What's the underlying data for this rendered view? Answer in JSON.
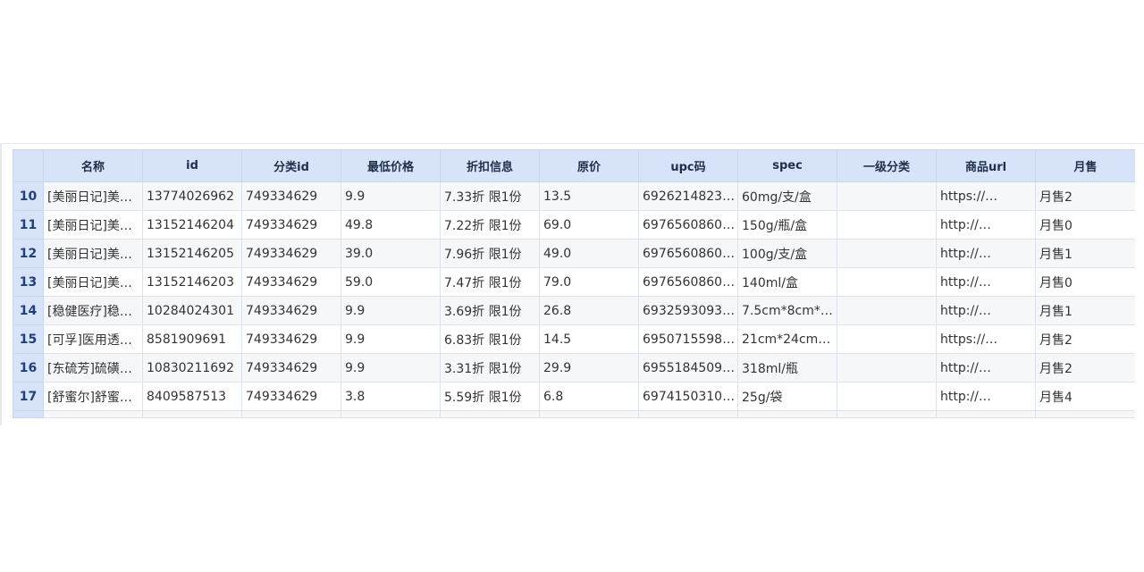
{
  "grid": {
    "columns": [
      "名称",
      "id",
      "分类id",
      "最低价格",
      "折扣信息",
      "原价",
      "upc码",
      "spec",
      "一级分类",
      "商品url",
      "月售"
    ],
    "rows": [
      {
        "num": "10",
        "cells": [
          "[美丽日记]美…",
          "13774026962",
          "749334629",
          "9.9",
          "7.33折 限1份",
          "13.5",
          "6926214823…",
          "60mg/支/盒",
          "",
          "https://…",
          "月售2"
        ]
      },
      {
        "num": "11",
        "cells": [
          "[美丽日记]美…",
          "13152146204",
          "749334629",
          "49.8",
          "7.22折 限1份",
          "69.0",
          "6976560860…",
          "150g/瓶/盒",
          "",
          "http://…",
          "月售0"
        ]
      },
      {
        "num": "12",
        "cells": [
          "[美丽日记]美…",
          "13152146205",
          "749334629",
          "39.0",
          "7.96折 限1份",
          "49.0",
          "6976560860…",
          "100g/支/盒",
          "",
          "http://…",
          "月售1"
        ]
      },
      {
        "num": "13",
        "cells": [
          "[美丽日记]美…",
          "13152146203",
          "749334629",
          "59.0",
          "7.47折 限1份",
          "79.0",
          "6976560860…",
          "140ml/盒",
          "",
          "http://…",
          "月售0"
        ]
      },
      {
        "num": "14",
        "cells": [
          "[稳健医疗]稳…",
          "10284024301",
          "749334629",
          "9.9",
          "3.69折 限1份",
          "26.8",
          "6932593093…",
          "7.5cm*8cm*…",
          "",
          "http://…",
          "月售1"
        ]
      },
      {
        "num": "15",
        "cells": [
          "[可孚]医用透…",
          "8581909691",
          "749334629",
          "9.9",
          "6.83折 限1份",
          "14.5",
          "6950715598…",
          "21cm*24cm…",
          "",
          "https://…",
          "月售2"
        ]
      },
      {
        "num": "16",
        "cells": [
          "[东硫芳]硫磺…",
          "10830211692",
          "749334629",
          "9.9",
          "3.31折 限1份",
          "29.9",
          "6955184509…",
          "318ml/瓶",
          "",
          "http://…",
          "月售2"
        ]
      },
      {
        "num": "17",
        "cells": [
          "[舒蜜尔]舒蜜…",
          "8409587513",
          "749334629",
          "3.8",
          "5.59折 限1份",
          "6.8",
          "6974150310…",
          "25g/袋",
          "",
          "http://…",
          "月售4"
        ]
      }
    ]
  }
}
